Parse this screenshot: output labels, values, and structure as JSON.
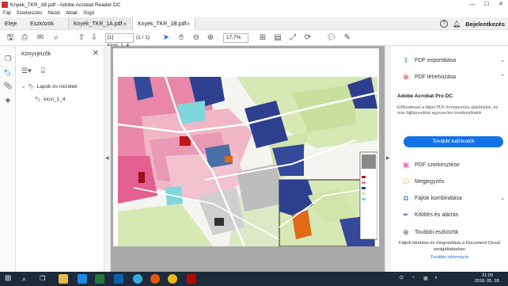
{
  "window": {
    "title": "Knyek_TKR_1B.pdf - Adobe Acrobat Reader DC"
  },
  "menu": [
    "Fájl",
    "Szerkesztés",
    "Nézet",
    "Ablak",
    "Súgó"
  ],
  "tabs": {
    "home": "Eleje",
    "tools": "Eszközök",
    "docs": [
      {
        "label": "Knyek_TKR_1A.pdf"
      },
      {
        "label": "Knyek_TKR_1B.pdf"
      }
    ]
  },
  "header": {
    "signin": "Bejelentkezés",
    "help": "?"
  },
  "toolbar": {
    "page_field": "[1] kicsi_1_4",
    "page_count": "(1 / 1)",
    "zoom": "17,7%"
  },
  "bookmarks": {
    "title": "Könyvjelzők",
    "items": [
      {
        "label": "Lapok és nézetek"
      },
      {
        "label": "kicsi_1_4"
      }
    ]
  },
  "right_pane": {
    "export": "PDF exportálása",
    "create": "PDF létrehozása",
    "promo": {
      "title": "Adobe Acrobat Pro DC",
      "body": "Előfizetéssel a fájlok PDF formátumúra alakíthatók, és más fájltípusokkal egyszerűen kombinálhatók",
      "button": "További tudnivalók"
    },
    "tools": [
      "PDF szerkesztése",
      "Megjegyzés",
      "Fájlok kombinálása",
      "Kitöltés és aláírás",
      "További eszközök"
    ],
    "cloud_text": "Fájlok tárolása és megosztása a Document Cloud szolgáltatásban",
    "cloud_link": "További információ"
  },
  "taskbar": {
    "time": "21:00",
    "date": "2018. 05. 18."
  },
  "colors": {
    "accent": "#1473e6",
    "acrobat_red": "#d32f2f",
    "taskbar": "#1c2a3a"
  }
}
